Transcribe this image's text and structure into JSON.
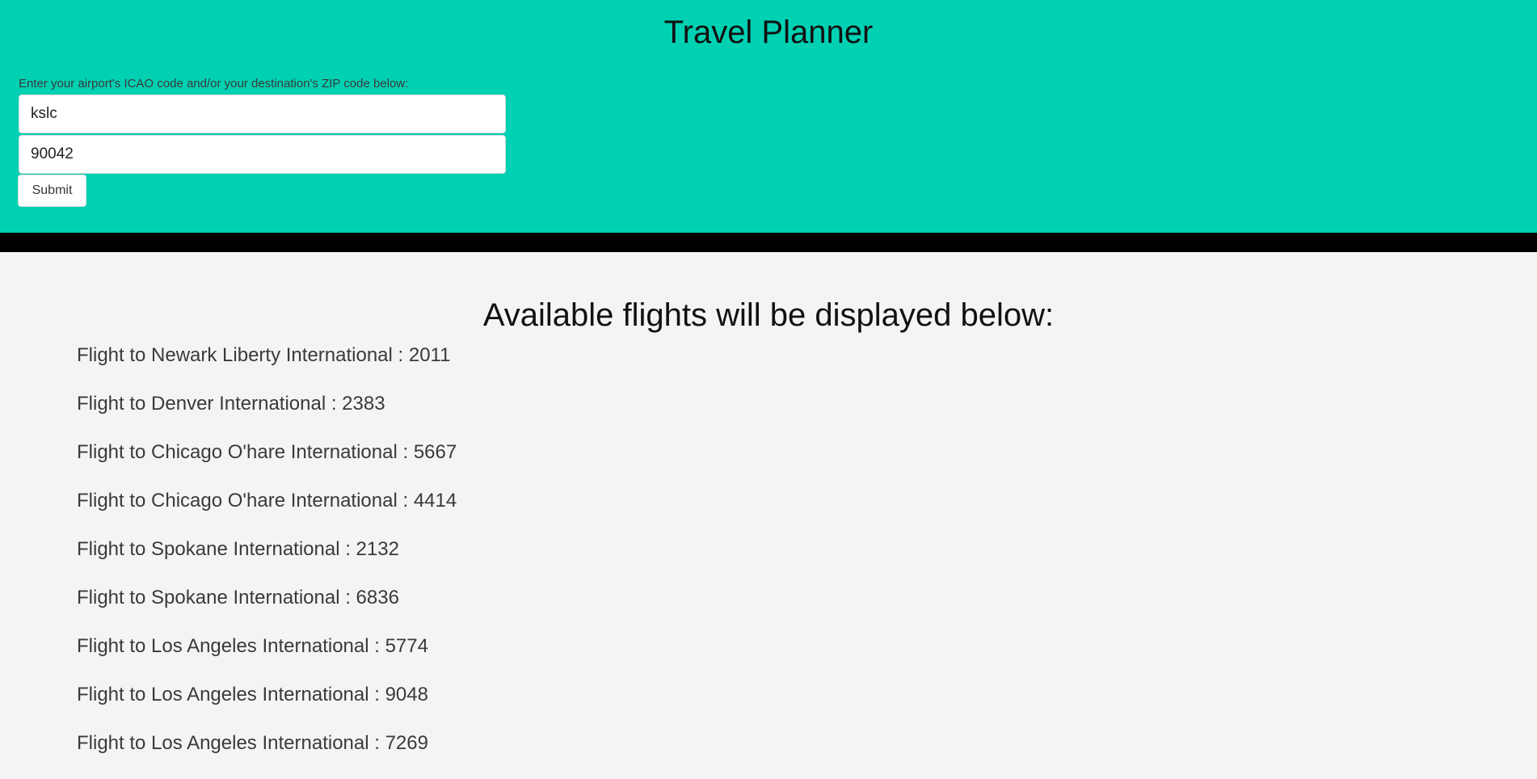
{
  "app": {
    "title": "Travel Planner"
  },
  "form": {
    "label": "Enter your airport's ICAO code and/or your destination's ZIP code below:",
    "icao_value": "kslc",
    "zip_value": "90042",
    "submit_label": "Submit"
  },
  "results": {
    "heading": "Available flights will be displayed below:",
    "flights": [
      "Flight to Newark Liberty International : 2011",
      "Flight to Denver International : 2383",
      "Flight to Chicago O'hare International : 5667",
      "Flight to Chicago O'hare International : 4414",
      "Flight to Spokane International : 2132",
      "Flight to Spokane International : 6836",
      "Flight to Los Angeles International : 5774",
      "Flight to Los Angeles International : 9048",
      "Flight to Los Angeles International : 7269"
    ]
  },
  "colors": {
    "header_bg": "#00d1b2",
    "divider": "#000000",
    "page_bg": "#f4f4f4"
  }
}
